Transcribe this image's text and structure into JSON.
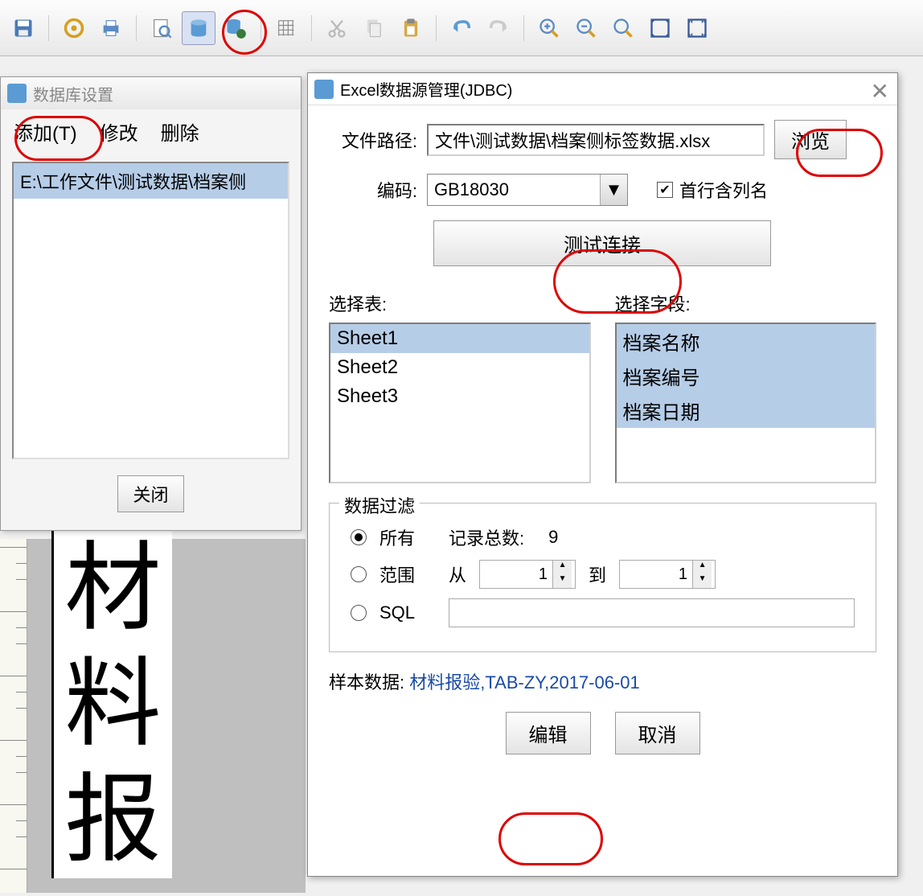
{
  "toolbar": {
    "icons": [
      "save",
      "gear",
      "print",
      "preview",
      "datasource",
      "datasource-cfg",
      "grid",
      "cut",
      "copy",
      "paste",
      "undo",
      "redo",
      "zoom-in",
      "zoom-out",
      "zoom-fit",
      "fit-page",
      "fit-width"
    ]
  },
  "db_settings": {
    "title": "数据库设置",
    "menu": {
      "add": "添加(T)",
      "modify": "修改",
      "delete": "删除"
    },
    "list_item": "E:\\工作文件\\测试数据\\档案侧",
    "close": "关闭"
  },
  "jdbc": {
    "title": "Excel数据源管理(JDBC)",
    "labels": {
      "filepath": "文件路径:",
      "encoding": "编码:",
      "firstrow": "首行含列名",
      "test": "测试连接",
      "select_table": "选择表:",
      "select_field": "选择字段:",
      "filter": "数据过滤",
      "all": "所有",
      "record_count": "记录总数:",
      "range": "范围",
      "from": "从",
      "to": "到",
      "sql": "SQL",
      "sample": "样本数据:",
      "edit": "编辑",
      "cancel": "取消",
      "browse": "浏览"
    },
    "filepath_value": "文件\\测试数据\\档案侧标签数据.xlsx",
    "encoding_value": "GB18030",
    "firstrow_checked": true,
    "tables": [
      "Sheet1",
      "Sheet2",
      "Sheet3"
    ],
    "selected_table": "Sheet1",
    "fields": [
      "档案名称",
      "档案编号",
      "档案日期"
    ],
    "record_count_value": "9",
    "range_from": "1",
    "range_to": "1",
    "sample_data": "材料报验,TAB-ZY,2017-06-01"
  },
  "canvas": {
    "vertical_chars": [
      "材",
      "料",
      "报"
    ]
  }
}
